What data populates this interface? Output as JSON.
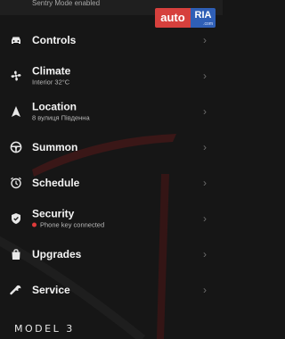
{
  "status": {
    "sentry_text": "Sentry Mode enabled"
  },
  "watermark": {
    "brand_left": "auto",
    "brand_right": "RIA",
    "domain": ".com"
  },
  "menu": {
    "items": [
      {
        "label": "Controls",
        "subtitle": "",
        "icon": "car-icon"
      },
      {
        "label": "Climate",
        "subtitle": "Interior 32°C",
        "icon": "fan-icon"
      },
      {
        "label": "Location",
        "subtitle": "8 вулиця Пiвденна",
        "icon": "navigation-arrow-icon"
      },
      {
        "label": "Summon",
        "subtitle": "",
        "icon": "steering-wheel-icon"
      },
      {
        "label": "Schedule",
        "subtitle": "",
        "icon": "clock-icon"
      },
      {
        "label": "Security",
        "subtitle": "Phone key connected",
        "icon": "shield-icon"
      },
      {
        "label": "Upgrades",
        "subtitle": "",
        "icon": "shopping-bag-icon"
      },
      {
        "label": "Service",
        "subtitle": "",
        "icon": "wrench-icon"
      }
    ]
  },
  "footer": {
    "model_name": "MODEL 3"
  },
  "colors": {
    "background": "#161616",
    "accent_red": "#e03a3a",
    "chevron": "#6c6c6c"
  }
}
